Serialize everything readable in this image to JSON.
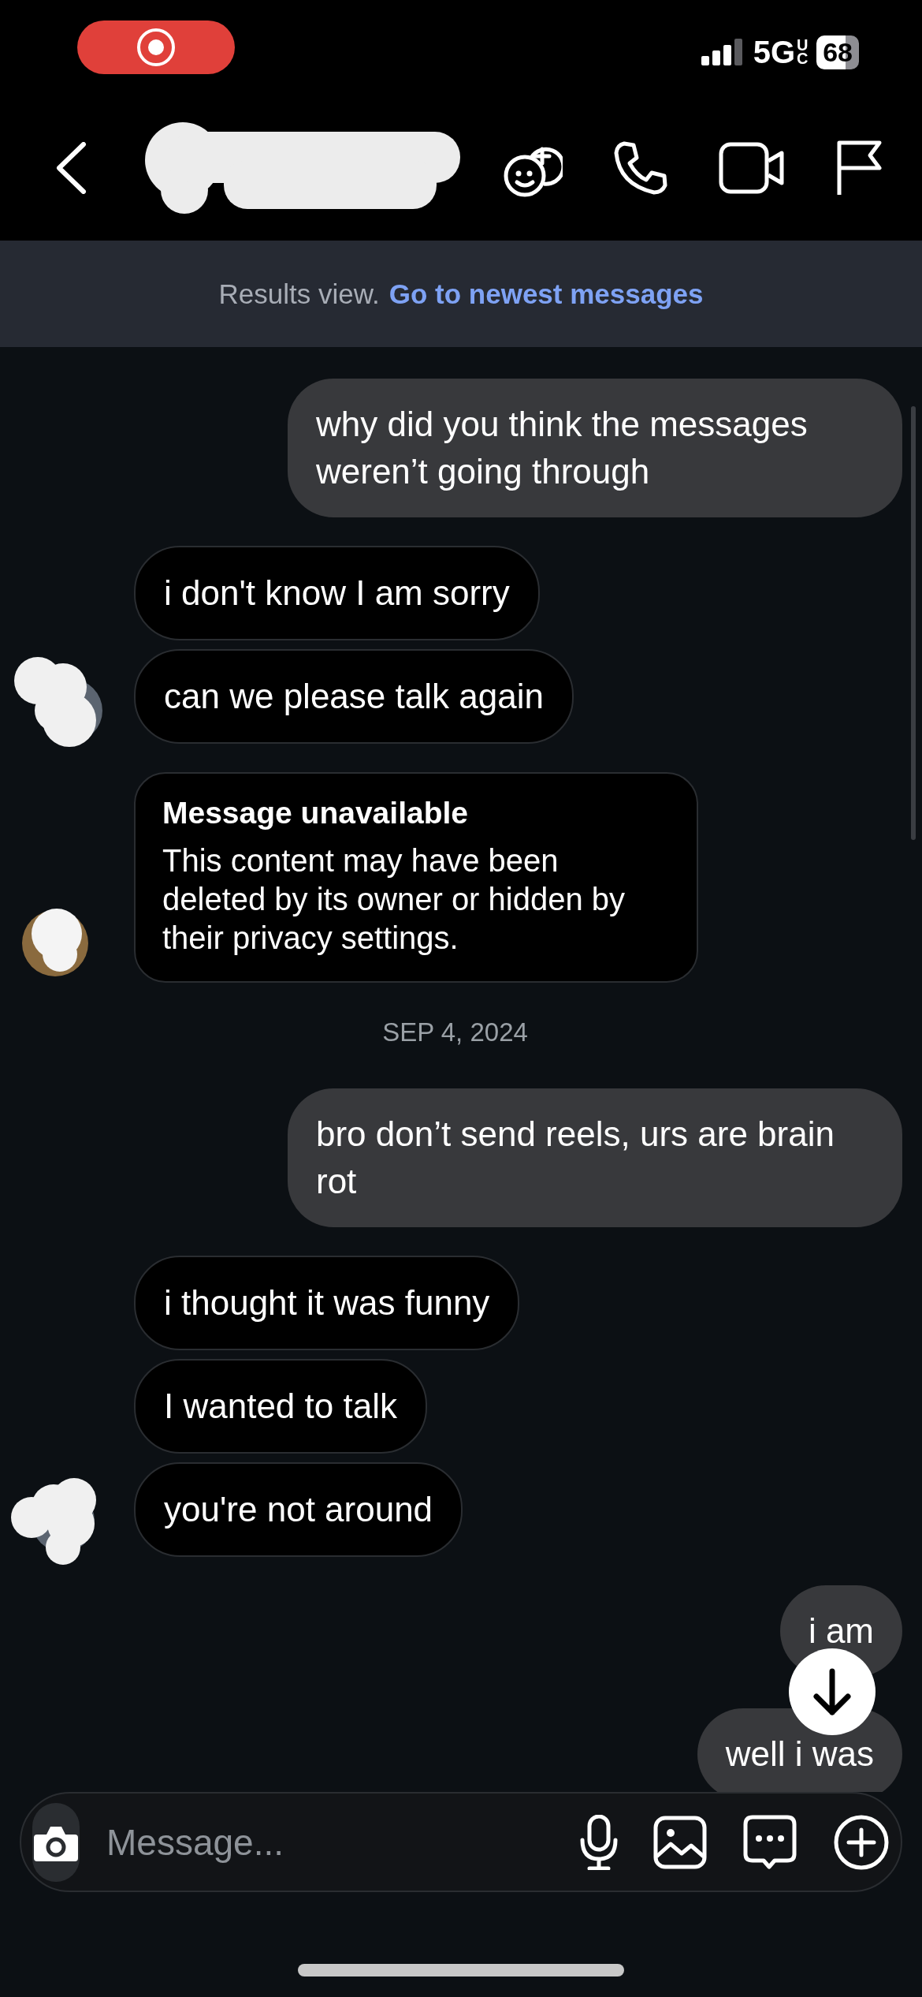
{
  "status_bar": {
    "recording": true,
    "network": "5G",
    "network_badge": "UC",
    "battery": "68"
  },
  "banner": {
    "text": "Results view.",
    "link": "Go to newest messages"
  },
  "thread": [
    {
      "kind": "outgoing",
      "messages": [
        "why did you think the messages weren’t going through"
      ]
    },
    {
      "kind": "incoming",
      "avatar": true,
      "messages": [
        "i don't know I am sorry",
        "can we please talk again"
      ]
    },
    {
      "kind": "unavailable",
      "avatar": true,
      "title": "Message unavailable",
      "body": "This content may have been deleted by its owner or hidden by their privacy settings."
    },
    {
      "kind": "date",
      "text": "SEP 4, 2024"
    },
    {
      "kind": "outgoing",
      "messages": [
        "bro don’t send reels, urs are brain rot"
      ]
    },
    {
      "kind": "incoming",
      "avatar": true,
      "messages": [
        "i thought it was funny",
        "I wanted to talk",
        "you're not around"
      ]
    },
    {
      "kind": "outgoing",
      "messages": [
        "i am",
        "well i was"
      ]
    }
  ],
  "composer": {
    "placeholder": "Message..."
  }
}
